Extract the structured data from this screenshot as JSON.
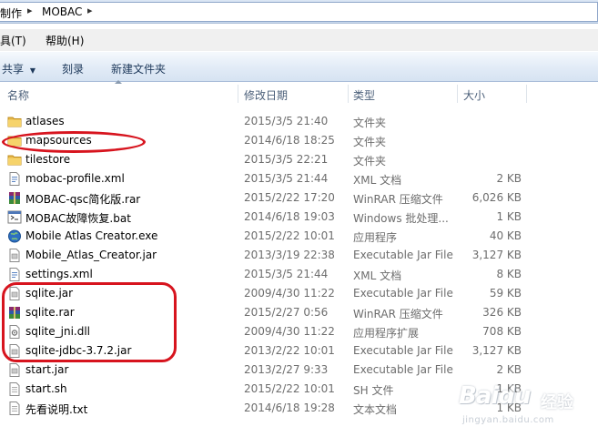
{
  "breadcrumb": {
    "prev": "制作",
    "current": "MOBAC"
  },
  "menu": {
    "tools": "工具(T)",
    "help": "帮助(H)"
  },
  "toolbar": {
    "share": "共享",
    "burn": "刻录",
    "new_folder": "新建文件夹"
  },
  "columns": {
    "name": "名称",
    "date": "修改日期",
    "type": "类型",
    "size": "大小"
  },
  "files": [
    {
      "name": "atlases",
      "date": "2015/3/5 21:40",
      "type": "文件夹",
      "size": "",
      "icon": "folder-icon"
    },
    {
      "name": "mapsources",
      "date": "2014/6/18 18:25",
      "type": "文件夹",
      "size": "",
      "icon": "folder-icon"
    },
    {
      "name": "tilestore",
      "date": "2015/3/5 22:21",
      "type": "文件夹",
      "size": "",
      "icon": "folder-icon"
    },
    {
      "name": "mobac-profile.xml",
      "date": "2015/3/5 21:44",
      "type": "XML 文档",
      "size": "2 KB",
      "icon": "xml-file-icon"
    },
    {
      "name": "MOBAC-qsc简化版.rar",
      "date": "2015/2/22 17:20",
      "type": "WinRAR 压缩文件",
      "size": "6,026 KB",
      "icon": "rar-archive-icon"
    },
    {
      "name": "MOBAC故障恢复.bat",
      "date": "2014/6/18 19:03",
      "type": "Windows 批处理...",
      "size": "1 KB",
      "icon": "batch-file-icon"
    },
    {
      "name": "Mobile Atlas Creator.exe",
      "date": "2015/2/22 10:01",
      "type": "应用程序",
      "size": "40 KB",
      "icon": "globe-exe-icon"
    },
    {
      "name": "Mobile_Atlas_Creator.jar",
      "date": "2013/3/19 22:38",
      "type": "Executable Jar File",
      "size": "3,127 KB",
      "icon": "jar-file-icon"
    },
    {
      "name": "settings.xml",
      "date": "2015/3/5 21:44",
      "type": "XML 文档",
      "size": "8 KB",
      "icon": "xml-file-icon"
    },
    {
      "name": "sqlite.jar",
      "date": "2009/4/30 11:22",
      "type": "Executable Jar File",
      "size": "59 KB",
      "icon": "jar-file-icon"
    },
    {
      "name": "sqlite.rar",
      "date": "2015/2/27 0:56",
      "type": "WinRAR 压缩文件",
      "size": "326 KB",
      "icon": "rar-archive-icon"
    },
    {
      "name": "sqlite_jni.dll",
      "date": "2009/4/30 11:22",
      "type": "应用程序扩展",
      "size": "708 KB",
      "icon": "dll-file-icon"
    },
    {
      "name": "sqlite-jdbc-3.7.2.jar",
      "date": "2013/2/22 10:01",
      "type": "Executable Jar File",
      "size": "3,127 KB",
      "icon": "jar-file-icon"
    },
    {
      "name": "start.jar",
      "date": "2013/2/27 9:33",
      "type": "Executable Jar File",
      "size": "2 KB",
      "icon": "jar-file-icon"
    },
    {
      "name": "start.sh",
      "date": "2015/2/22 10:01",
      "type": "SH 文件",
      "size": "1 KB",
      "icon": "text-file-icon"
    },
    {
      "name": "先看说明.txt",
      "date": "2014/6/18 19:28",
      "type": "文本文档",
      "size": "1 KB",
      "icon": "text-file-icon"
    }
  ],
  "watermark": {
    "logo": "Baidu",
    "sub": "经验",
    "url": "jingyan.baidu.com"
  }
}
